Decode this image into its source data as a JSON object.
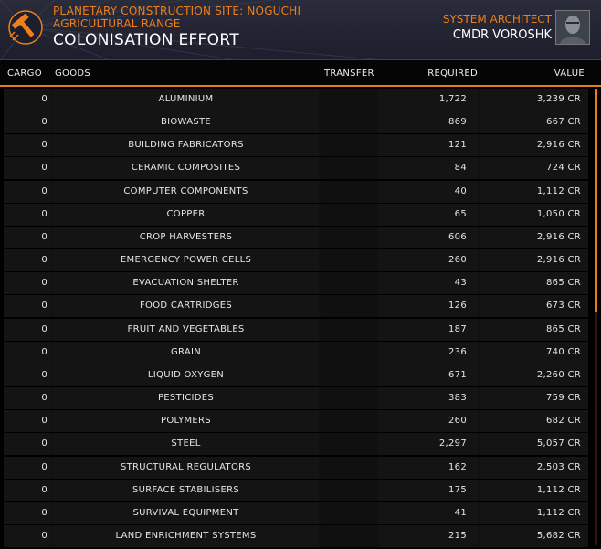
{
  "header": {
    "site_line1": "PLANETARY CONSTRUCTION SITE: NOGUCHI",
    "site_line2": "AGRICULTURAL RANGE",
    "title": "COLONISATION EFFORT",
    "role": "SYSTEM ARCHITECT",
    "commander": "CMDR VOROSHK",
    "logo_icon": "construction-hammer-icon",
    "avatar_icon": "commander-portrait"
  },
  "columns": {
    "cargo": "CARGO",
    "goods": "GOODS",
    "transfer": "TRANSFER",
    "required": "REQUIRED",
    "value": "VALUE"
  },
  "rows": [
    {
      "cargo": "0",
      "goods": "ALUMINIUM",
      "required": "1,722",
      "value": "3,239 CR"
    },
    {
      "cargo": "0",
      "goods": "BIOWASTE",
      "required": "869",
      "value": "667 CR"
    },
    {
      "cargo": "0",
      "goods": "BUILDING FABRICATORS",
      "required": "121",
      "value": "2,916 CR"
    },
    {
      "cargo": "0",
      "goods": "CERAMIC COMPOSITES",
      "required": "84",
      "value": "724 CR"
    },
    {
      "cargo": "0",
      "goods": "COMPUTER COMPONENTS",
      "required": "40",
      "value": "1,112 CR"
    },
    {
      "cargo": "0",
      "goods": "COPPER",
      "required": "65",
      "value": "1,050 CR"
    },
    {
      "cargo": "0",
      "goods": "CROP HARVESTERS",
      "required": "606",
      "value": "2,916 CR"
    },
    {
      "cargo": "0",
      "goods": "EMERGENCY POWER CELLS",
      "required": "260",
      "value": "2,916 CR"
    },
    {
      "cargo": "0",
      "goods": "EVACUATION SHELTER",
      "required": "43",
      "value": "865 CR"
    },
    {
      "cargo": "0",
      "goods": "FOOD CARTRIDGES",
      "required": "126",
      "value": "673 CR"
    },
    {
      "cargo": "0",
      "goods": "FRUIT AND VEGETABLES",
      "required": "187",
      "value": "865 CR"
    },
    {
      "cargo": "0",
      "goods": "GRAIN",
      "required": "236",
      "value": "740 CR"
    },
    {
      "cargo": "0",
      "goods": "LIQUID OXYGEN",
      "required": "671",
      "value": "2,260 CR"
    },
    {
      "cargo": "0",
      "goods": "PESTICIDES",
      "required": "383",
      "value": "759 CR"
    },
    {
      "cargo": "0",
      "goods": "POLYMERS",
      "required": "260",
      "value": "682 CR"
    },
    {
      "cargo": "0",
      "goods": "STEEL",
      "required": "2,297",
      "value": "5,057 CR"
    },
    {
      "cargo": "0",
      "goods": "STRUCTURAL REGULATORS",
      "required": "162",
      "value": "2,503 CR"
    },
    {
      "cargo": "0",
      "goods": "SURFACE STABILISERS",
      "required": "175",
      "value": "1,112 CR"
    },
    {
      "cargo": "0",
      "goods": "SURVIVAL EQUIPMENT",
      "required": "41",
      "value": "1,112 CR"
    },
    {
      "cargo": "0",
      "goods": "LAND ENRICHMENT SYSTEMS",
      "required": "215",
      "value": "5,682 CR"
    }
  ],
  "colors": {
    "accent": "#ee7f1a",
    "background": "#000000",
    "row": "#141414"
  }
}
